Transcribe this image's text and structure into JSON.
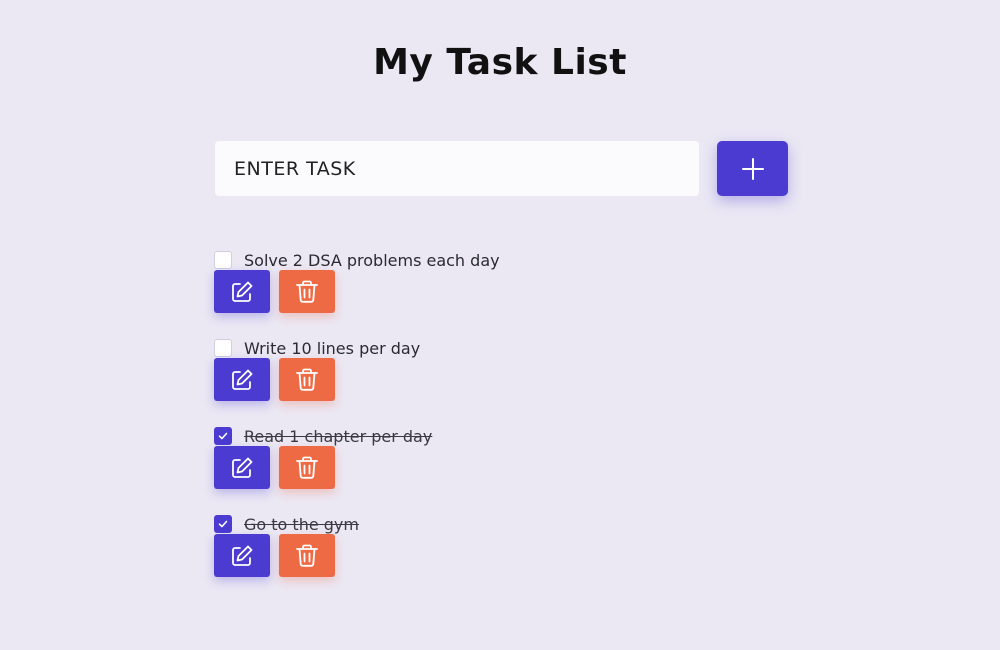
{
  "header": {
    "title": "My Task List"
  },
  "new_task": {
    "placeholder": "ENTER TASK",
    "value": "",
    "add_icon": "plus-icon"
  },
  "colors": {
    "background": "#ebe8f4",
    "primary": "#4b3bd0",
    "danger": "#ee6a44"
  },
  "tasks": [
    {
      "text": "Solve 2 DSA problems each day",
      "completed": false,
      "edit_icon": "pencil-square-icon",
      "delete_icon": "trash-icon"
    },
    {
      "text": "Write 10 lines per day",
      "completed": false,
      "edit_icon": "pencil-square-icon",
      "delete_icon": "trash-icon"
    },
    {
      "text": "Read 1 chapter per day",
      "completed": true,
      "edit_icon": "pencil-square-icon",
      "delete_icon": "trash-icon"
    },
    {
      "text": "Go to the gym",
      "completed": true,
      "edit_icon": "pencil-square-icon",
      "delete_icon": "trash-icon"
    }
  ]
}
